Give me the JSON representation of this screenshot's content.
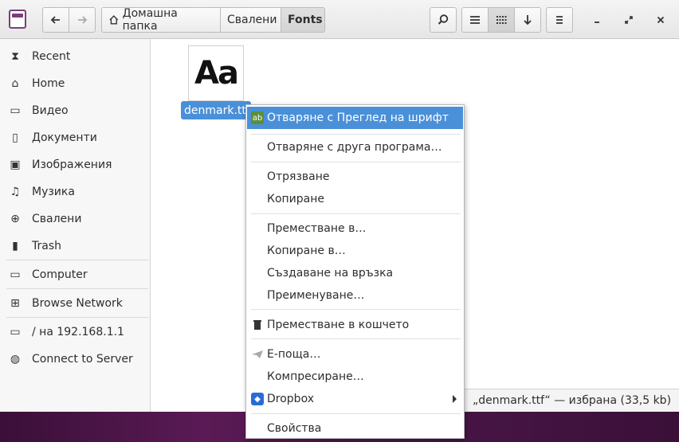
{
  "header": {
    "breadcrumbs": [
      "Домашна папка",
      "Свалени",
      "Fonts"
    ],
    "window_controls": [
      "minimize",
      "maximize",
      "close"
    ]
  },
  "sidebar": {
    "items": [
      {
        "label": "Recent",
        "icon": "recent-icon"
      },
      {
        "label": "Home",
        "icon": "home-icon"
      },
      {
        "label": "Видео",
        "icon": "video-icon"
      },
      {
        "label": "Документи",
        "icon": "documents-icon"
      },
      {
        "label": "Изображения",
        "icon": "pictures-icon"
      },
      {
        "label": "Музика",
        "icon": "music-icon"
      },
      {
        "label": "Свалени",
        "icon": "downloads-icon"
      },
      {
        "label": "Trash",
        "icon": "trash-icon"
      },
      {
        "label": "Computer",
        "icon": "computer-icon"
      },
      {
        "label": "Browse Network",
        "icon": "network-icon"
      },
      {
        "label": "/ на 192.168.1.1",
        "icon": "network-share-icon"
      },
      {
        "label": "Connect to Server",
        "icon": "globe-icon"
      }
    ]
  },
  "file": {
    "thumbnail_text": "Aa",
    "name": "denmark.ttf"
  },
  "status": "„denmark.ttf“ — избрана (33,5 kb)",
  "context_menu": {
    "items": [
      {
        "label": "Отваряне с Преглед на шрифт",
        "highlighted": true,
        "icon": "font-viewer-icon"
      },
      {
        "label": "Отваряне с друга програма…"
      },
      {
        "label": "Отрязване"
      },
      {
        "label": "Копиране"
      },
      {
        "label": "Преместване в…"
      },
      {
        "label": "Копиране в…"
      },
      {
        "label": "Създаване на връзка"
      },
      {
        "label": "Преименуване…"
      },
      {
        "label": "Преместване в кошчето",
        "icon": "trash-icon"
      },
      {
        "label": "Е-поща…",
        "icon": "mail-icon"
      },
      {
        "label": "Компресиране…"
      },
      {
        "label": "Dropbox",
        "icon": "dropbox-icon",
        "submenu": true
      },
      {
        "label": "Свойства"
      }
    ]
  },
  "colors": {
    "accent": "#4a90d9",
    "desktop": "#4a1648"
  }
}
